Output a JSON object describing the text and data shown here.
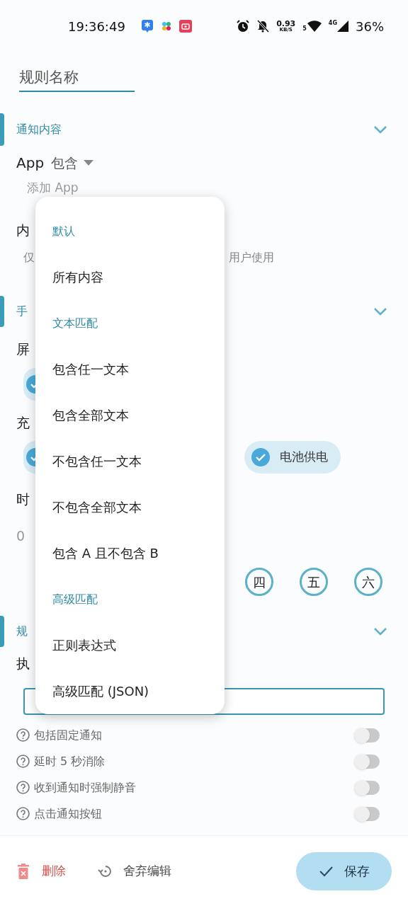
{
  "status_bar": {
    "time": "19:36:49",
    "net_speed": "0.93",
    "net_unit": "KB/S",
    "wifi_badge": "5",
    "cell_badge": "4G",
    "battery": "36%"
  },
  "rule_name": {
    "placeholder": "规则名称"
  },
  "notification": {
    "title": "通知内容",
    "app_label": "App",
    "app_mode": "包含",
    "app_field": {
      "placeholder": "添加 App"
    },
    "content_label": "内",
    "hint_start": "仅",
    "hint_end": "用户使用"
  },
  "phone": {
    "title": "手",
    "screen_label": "屏",
    "screen_chips": [
      {
        "checked": true
      }
    ],
    "charge_label": "充",
    "charge_chips": [
      {
        "checked": true
      },
      {
        "label": "电池供电",
        "checked": true
      }
    ],
    "time_label": "时",
    "time_value": "0",
    "weekdays": [
      "四",
      "五",
      "六"
    ]
  },
  "rules": {
    "title": "规",
    "exec_label": "执",
    "toggles": [
      {
        "label": "包括固定通知",
        "on": false
      },
      {
        "label": "延时 5 秒消除",
        "on": false
      },
      {
        "label": "收到通知时强制静音",
        "on": false
      },
      {
        "label": "点击通知按钮",
        "on": false
      }
    ]
  },
  "footer": {
    "delete": "删除",
    "discard": "舍弃编辑",
    "save": "保存"
  },
  "menu": {
    "items": [
      {
        "kind": "header",
        "label": "默认"
      },
      {
        "kind": "option",
        "label": "所有内容"
      },
      {
        "kind": "header",
        "label": "文本匹配"
      },
      {
        "kind": "option",
        "label": "包含任一文本"
      },
      {
        "kind": "option",
        "label": "包含全部文本"
      },
      {
        "kind": "option",
        "label": "不包含任一文本"
      },
      {
        "kind": "option",
        "label": "不包含全部文本"
      },
      {
        "kind": "option",
        "label": "包含 A 且不包含 B"
      },
      {
        "kind": "header",
        "label": "高级匹配"
      },
      {
        "kind": "option",
        "label": "正则表达式"
      },
      {
        "kind": "option",
        "label": "高级匹配 (JSON)"
      }
    ]
  }
}
